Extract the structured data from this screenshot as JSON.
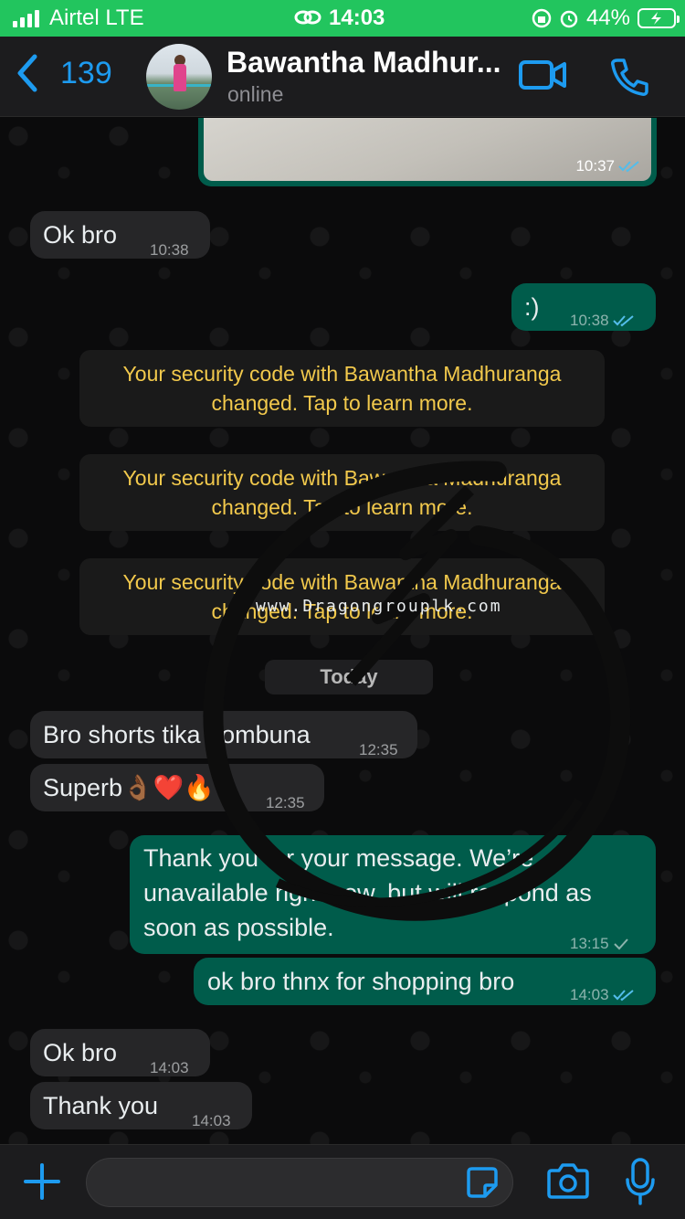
{
  "status_bar": {
    "carrier": "Airtel  LTE",
    "time": "14:03",
    "battery": "44%"
  },
  "header": {
    "back_count": "139",
    "contact_name": "Bawantha Madhur...",
    "contact_status": "online",
    "accent": "#1d9bf0"
  },
  "messages": {
    "image_time": "10:37",
    "m1": {
      "text": "Ok bro",
      "time": "10:38"
    },
    "m2": {
      "text": ":)",
      "time": "10:38"
    },
    "sys1": "Your security code with Bawantha Madhuranga changed. Tap to learn more.",
    "sys2": "Your security code with Bawantha Madhuranga changed. Tap to learn more.",
    "sys3": "Your security code with Bawantha Madhuranga changed. Tap to learn more.",
    "today": "Today",
    "m3": {
      "text": "Bro shorts tika hombuna",
      "time": "12:35"
    },
    "m4": {
      "text": "Superb👌🏾❤️🔥",
      "time": "12:35"
    },
    "m5": {
      "text": "Thank you for your message. We’re unavailable right now, but will respond as soon as possible.",
      "time": "13:15"
    },
    "m6": {
      "text": "ok bro thnx for shopping bro",
      "time": "14:03"
    },
    "m7": {
      "text": "Ok bro",
      "time": "14:03"
    },
    "m8": {
      "text": "Thank you",
      "time": "14:03"
    }
  },
  "watermark": {
    "text": "www.Dragongrouplk.com"
  },
  "input": {
    "value": "",
    "placeholder": ""
  },
  "colors": {
    "status_bar": "#22c55e",
    "outgoing": "#005c4b",
    "incoming": "#262628",
    "system_text": "#f2c94c"
  }
}
